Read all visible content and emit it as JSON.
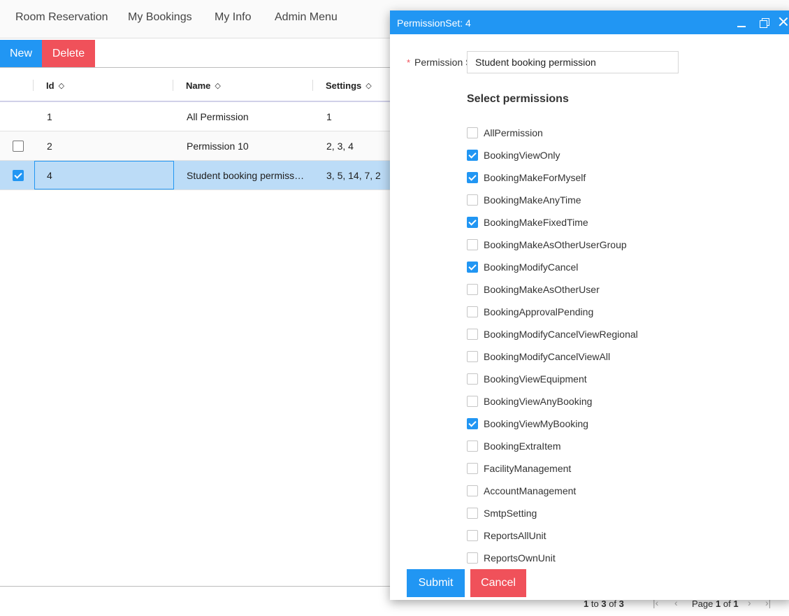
{
  "nav": {
    "items": [
      "Room Reservation",
      "My Bookings",
      "My Info",
      "Admin Menu"
    ]
  },
  "toolbar": {
    "new_label": "New",
    "delete_label": "Delete"
  },
  "grid": {
    "columns": [
      "Id",
      "Name",
      "Settings"
    ],
    "rows": [
      {
        "checked": null,
        "id": "1",
        "name": "All Permission",
        "settings": "1"
      },
      {
        "checked": false,
        "id": "2",
        "name": "Permission 10",
        "settings": "2, 3, 4"
      },
      {
        "checked": true,
        "id": "4",
        "name": "Student booking permiss…",
        "settings": "3, 5, 14, 7, 2"
      }
    ],
    "paging": {
      "range_start": "1",
      "range_word": "to",
      "range_end": "3",
      "of_word": "of",
      "total": "3",
      "page_word": "Page",
      "page": "1",
      "page_of_word": "of",
      "page_total": "1"
    }
  },
  "dialog": {
    "title": "PermissionSet: 4",
    "field_label": "Permission Set Name",
    "field_value": "Student booking permission",
    "section_title": "Select permissions",
    "permissions": [
      {
        "label": "AllPermission",
        "checked": false
      },
      {
        "label": "BookingViewOnly",
        "checked": true
      },
      {
        "label": "BookingMakeForMyself",
        "checked": true
      },
      {
        "label": "BookingMakeAnyTime",
        "checked": false
      },
      {
        "label": "BookingMakeFixedTime",
        "checked": true
      },
      {
        "label": "BookingMakeAsOtherUserGroup",
        "checked": false
      },
      {
        "label": "BookingModifyCancel",
        "checked": true
      },
      {
        "label": "BookingMakeAsOtherUser",
        "checked": false
      },
      {
        "label": "BookingApprovalPending",
        "checked": false
      },
      {
        "label": "BookingModifyCancelViewRegional",
        "checked": false
      },
      {
        "label": "BookingModifyCancelViewAll",
        "checked": false
      },
      {
        "label": "BookingViewEquipment",
        "checked": false
      },
      {
        "label": "BookingViewAnyBooking",
        "checked": false
      },
      {
        "label": "BookingViewMyBooking",
        "checked": true
      },
      {
        "label": "BookingExtraItem",
        "checked": false
      },
      {
        "label": "FacilityManagement",
        "checked": false
      },
      {
        "label": "AccountManagement",
        "checked": false
      },
      {
        "label": "SmtpSetting",
        "checked": false
      },
      {
        "label": "ReportsAllUnit",
        "checked": false
      },
      {
        "label": "ReportsOwnUnit",
        "checked": false
      }
    ],
    "submit_label": "Submit",
    "cancel_label": "Cancel"
  },
  "colors": {
    "primary": "#2196f3",
    "danger": "#f0515a",
    "selected_row": "#bcdcf7"
  }
}
